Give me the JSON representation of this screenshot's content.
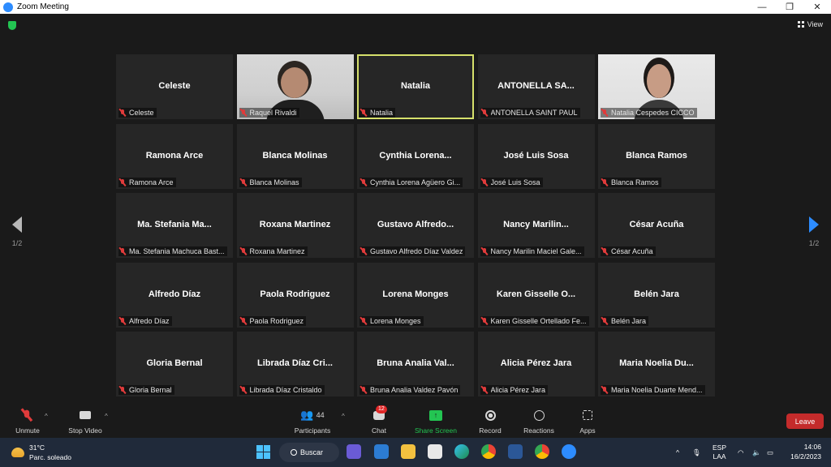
{
  "window": {
    "title": "Zoom Meeting",
    "controls": [
      "—",
      "❐",
      "✕"
    ]
  },
  "header": {
    "view_label": "View"
  },
  "pagination": {
    "left": "1/2",
    "right": "1/2"
  },
  "participants": [
    {
      "display": "Celeste",
      "label": "Celeste",
      "video": false
    },
    {
      "display": "",
      "label": "Raquel Rivaldi",
      "video": true
    },
    {
      "display": "Natalia",
      "label": "Natalia",
      "video": false,
      "active": true
    },
    {
      "display": "ANTONELLA SA...",
      "label": "ANTONELLA SAINT PAUL",
      "video": false
    },
    {
      "display": "",
      "label": "Natalia Cespedes CICCO",
      "video": true
    },
    {
      "display": "Ramona Arce",
      "label": "Ramona Arce",
      "video": false
    },
    {
      "display": "Blanca Molinas",
      "label": "Blanca Molinas",
      "video": false
    },
    {
      "display": "Cynthia Lorena...",
      "label": "Cynthia Lorena Agüero Gi...",
      "video": false
    },
    {
      "display": "José Luis Sosa",
      "label": "José Luis Sosa",
      "video": false
    },
    {
      "display": "Blanca Ramos",
      "label": "Blanca Ramos",
      "video": false
    },
    {
      "display": "Ma. Stefania Ma...",
      "label": "Ma. Stefania Machuca Bast...",
      "video": false
    },
    {
      "display": "Roxana Martinez",
      "label": "Roxana Martinez",
      "video": false
    },
    {
      "display": "Gustavo Alfredo...",
      "label": "Gustavo Alfredo Díaz Valdez",
      "video": false
    },
    {
      "display": "Nancy Marilin...",
      "label": "Nancy Marilin Maciel Gale...",
      "video": false
    },
    {
      "display": "César Acuña",
      "label": "César Acuña",
      "video": false
    },
    {
      "display": "Alfredo Díaz",
      "label": "Alfredo Díaz",
      "video": false
    },
    {
      "display": "Paola Rodriguez",
      "label": "Paola Rodriguez",
      "video": false
    },
    {
      "display": "Lorena Monges",
      "label": "Lorena Monges",
      "video": false
    },
    {
      "display": "Karen Gisselle O...",
      "label": "Karen Gisselle Ortellado Fe...",
      "video": false
    },
    {
      "display": "Belén Jara",
      "label": "Belén Jara",
      "video": false
    },
    {
      "display": "Gloria Bernal",
      "label": "Gloria Bernal",
      "video": false
    },
    {
      "display": "Librada Díaz Cri...",
      "label": "Librada Díaz Cristaldo",
      "video": false
    },
    {
      "display": "Bruna Analia Val...",
      "label": "Bruna Analia Valdez Pavón",
      "video": false
    },
    {
      "display": "Alicia Pérez Jara",
      "label": "Alicia Pérez Jara",
      "video": false
    },
    {
      "display": "Maria Noelia Du...",
      "label": "Maria Noelia Duarte Mend...",
      "video": false
    }
  ],
  "toolbar": {
    "unmute": "Unmute",
    "stop_video": "Stop Video",
    "participants": "Participants",
    "participants_count": "44",
    "chat": "Chat",
    "chat_badge": "12",
    "share_screen": "Share Screen",
    "record": "Record",
    "reactions": "Reactions",
    "apps": "Apps",
    "leave": "Leave"
  },
  "taskbar": {
    "temperature": "31°C",
    "weather_desc": "Parc. soleado",
    "search": "Buscar",
    "language_top": "ESP",
    "language_bottom": "LAA",
    "time": "14:06",
    "date": "16/2/2023"
  },
  "colors": {
    "accent": "#2d8cff",
    "active_speaker": "#d6e06b",
    "leave": "#c42b2b",
    "share": "#23c552",
    "muted": "#e03b3b"
  }
}
